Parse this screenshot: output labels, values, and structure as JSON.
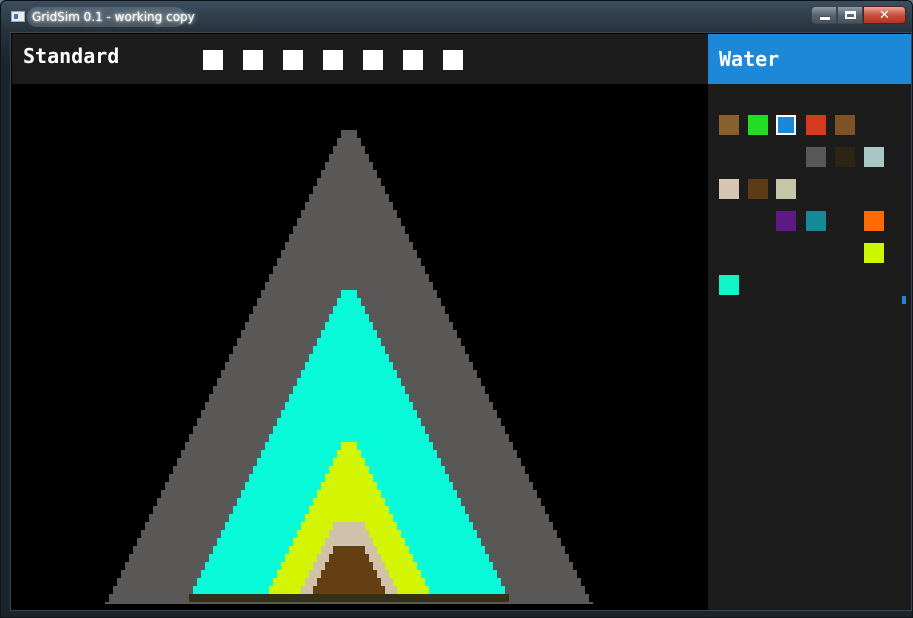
{
  "window": {
    "title": "GridSim 0.1 - working copy",
    "buttons": {
      "minimize_icon": "minimize-icon",
      "maximize_icon": "maximize-icon",
      "close_icon": "close-icon",
      "close_glyph": "✕"
    }
  },
  "header": {
    "mode_title": "Standard",
    "slot_count": 7,
    "slot_color": "#ffffff"
  },
  "sidebar": {
    "selected_element": "Water",
    "selected_color": "#1e88d8",
    "palette": [
      {
        "name": "swatch-brown",
        "color": "#8a5f2e"
      },
      {
        "name": "swatch-green",
        "color": "#22dd22"
      },
      {
        "name": "swatch-water",
        "color": "#1e88d8",
        "selected": true
      },
      {
        "name": "swatch-red",
        "color": "#d63a1e"
      },
      {
        "name": "swatch-dark-brown",
        "color": "#7e5226"
      },
      {
        "name": "swatch-stone",
        "color": "#5a5856"
      },
      {
        "name": "swatch-dark",
        "color": "#2e2414"
      },
      {
        "name": "swatch-pale-cyan",
        "color": "#a8c6c6"
      },
      {
        "name": "swatch-beige",
        "color": "#d4c6b2"
      },
      {
        "name": "swatch-mud",
        "color": "#5c3c14"
      },
      {
        "name": "swatch-sage",
        "color": "#c4c8a8"
      },
      {
        "name": "swatch-purple",
        "color": "#5c1a82"
      },
      {
        "name": "swatch-teal",
        "color": "#138a96"
      },
      {
        "name": "swatch-orange",
        "color": "#ff6a00"
      },
      {
        "name": "swatch-lime",
        "color": "#ccf500"
      },
      {
        "name": "swatch-aqua",
        "color": "#10f5c8"
      }
    ]
  },
  "colors": {
    "stone": "#5a5856",
    "aqua": "#08fbd8",
    "lime": "#d4f502",
    "sand": "#cfc1aa",
    "mud": "#633f12",
    "base": "#353018",
    "background": "#000000",
    "panel": "#1c1c1c"
  }
}
